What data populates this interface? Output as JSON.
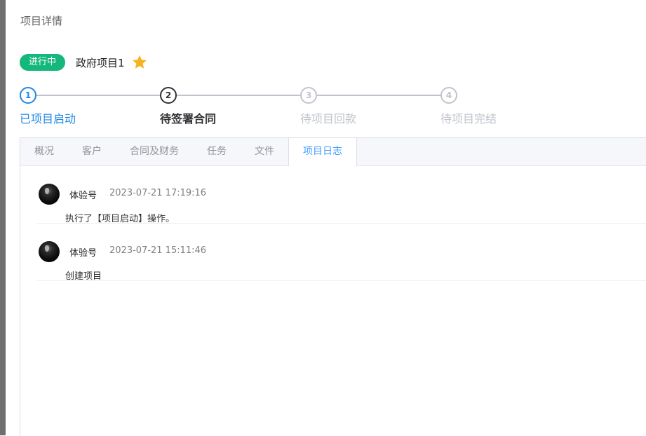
{
  "page": {
    "title": "项目详情"
  },
  "project": {
    "status": "进行中",
    "name": "政府项目1"
  },
  "steps": [
    {
      "number": "1",
      "label": "已项目启动",
      "state": "done"
    },
    {
      "number": "2",
      "label": "待签署合同",
      "state": "active"
    },
    {
      "number": "3",
      "label": "待项目回款",
      "state": "pending"
    },
    {
      "number": "4",
      "label": "待项目完结",
      "state": "pending"
    }
  ],
  "tabs": [
    {
      "label": "概况"
    },
    {
      "label": "客户"
    },
    {
      "label": "合同及财务"
    },
    {
      "label": "任务"
    },
    {
      "label": "文件"
    },
    {
      "label": "项目日志"
    }
  ],
  "active_tab": "项目日志",
  "logs": [
    {
      "user": "体验号",
      "time": "2023-07-21 17:19:16",
      "text": "执行了【项目启动】操作。"
    },
    {
      "user": "体验号",
      "time": "2023-07-21 15:11:46",
      "text": "创建项目"
    }
  ],
  "icons": {
    "favorite": "star-icon"
  },
  "colors": {
    "status_badge": "#14b77c",
    "accent": "#409eff",
    "step_done": "#1e88e5",
    "star": "#f5b41f"
  }
}
